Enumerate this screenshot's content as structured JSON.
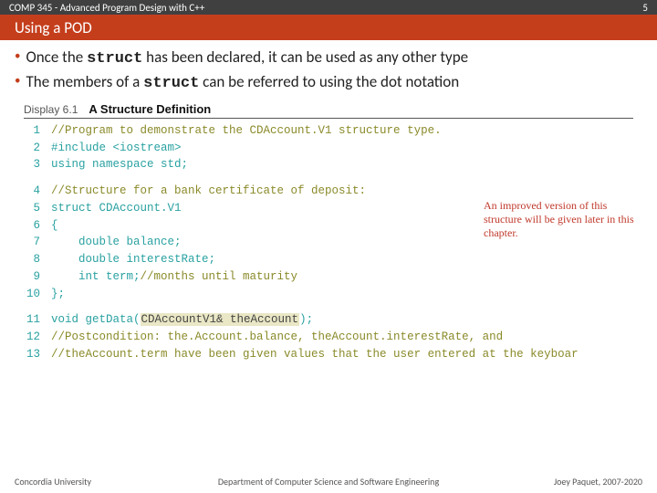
{
  "header": {
    "course": "COMP 345 - Advanced Program Design with C++",
    "slide_number": "5"
  },
  "title": "Using a POD",
  "bullets": {
    "b1_pre": "Once the ",
    "b1_kw": "struct",
    "b1_post": " has been declared, it can be used as any other type",
    "b2_pre": "The members of a ",
    "b2_kw": "struct",
    "b2_post": " can be referred to using the dot notation"
  },
  "figure": {
    "number": "Display 6.1",
    "title": "A Structure Definition",
    "annotation": "An improved version of this structure will be given later in this chapter.",
    "lines": {
      "l1": {
        "n": "1",
        "code": "//Program to demonstrate the CDAccount.V1 structure type.",
        "class": "c-comment"
      },
      "l2": {
        "n": "2",
        "code": "#include <iostream>"
      },
      "l3": {
        "n": "3",
        "code": "using namespace std;"
      },
      "l4": {
        "n": "4",
        "code": "//Structure for a bank certificate of deposit:",
        "class": "c-comment"
      },
      "l5": {
        "n": "5",
        "code": "struct CDAccount.V1"
      },
      "l6": {
        "n": "6",
        "code": "{"
      },
      "l7": {
        "n": "7",
        "code": "    double balance;"
      },
      "l8": {
        "n": "8",
        "code": "    double interestRate;"
      },
      "l9a": {
        "n": "9",
        "code": "    int term;"
      },
      "l9b": {
        "code": "//months until maturity",
        "class": "c-comment"
      },
      "l10": {
        "n": "10",
        "code": "};"
      },
      "l11a": {
        "n": "11",
        "pre": "void getData(",
        "arg": "CDAccountV1& theAccount",
        "post": ");"
      },
      "l12": {
        "n": "12",
        "code": "//Postcondition: the.Account.balance, theAccount.interestRate, and",
        "class": "c-comment"
      },
      "l13": {
        "n": "13",
        "code": "//theAccount.term have been given values that the user entered at the keyboar",
        "class": "c-comment"
      }
    }
  },
  "footer": {
    "left": "Concordia University",
    "mid": "Department of Computer Science and Software Engineering",
    "right": "Joey Paquet, 2007-2020"
  }
}
